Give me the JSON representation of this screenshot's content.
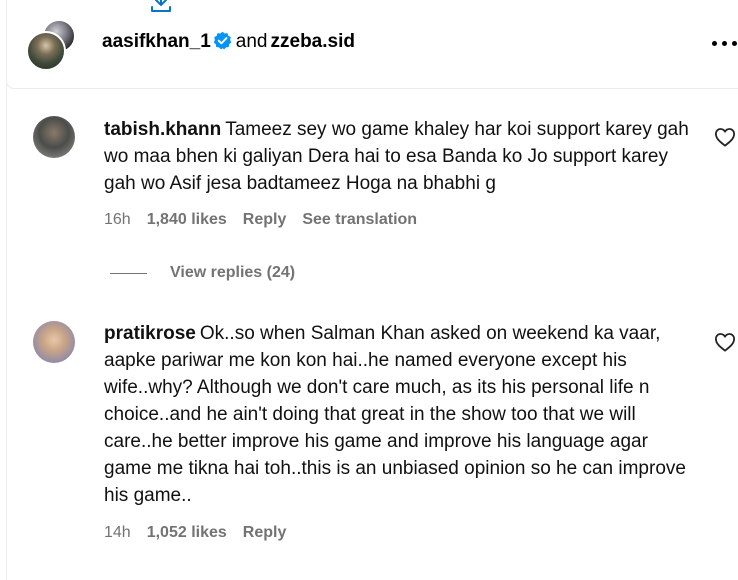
{
  "header": {
    "user1": "aasifkhan_1",
    "conjunction": "and",
    "user2": "zzeba.sid"
  },
  "comments": [
    {
      "username": "tabish.khann",
      "text": "Tameez sey wo game khaley har koi support karey gah wo maa bhen ki galiyan Dera hai to esa Banda ko Jo support karey gah wo Asif jesa badtameez Hoga na bhabhi g",
      "time": "16h",
      "likes": "1,840 likes",
      "reply": "Reply",
      "translate": "See translation",
      "view_replies": "View replies (24)"
    },
    {
      "username": "pratikrose",
      "text": "Ok..so when Salman Khan asked on weekend ka vaar, aapke pariwar me kon kon hai..he named everyone except his wife..why? Although we don't care much, as its his personal life n choice..and he ain't doing that great in the show too that we will care..he better improve his game and improve his language agar game me tikna hai toh..this is an unbiased opinion so he can improve his game..",
      "time": "14h",
      "likes": "1,052 likes",
      "reply": "Reply"
    }
  ],
  "colors": {
    "verified": "#0095f6",
    "meta": "#737373",
    "divider": "#e6e6e6"
  },
  "icons": [
    "download-icon",
    "verified-badge-icon",
    "more-options-icon",
    "heart-icon"
  ]
}
